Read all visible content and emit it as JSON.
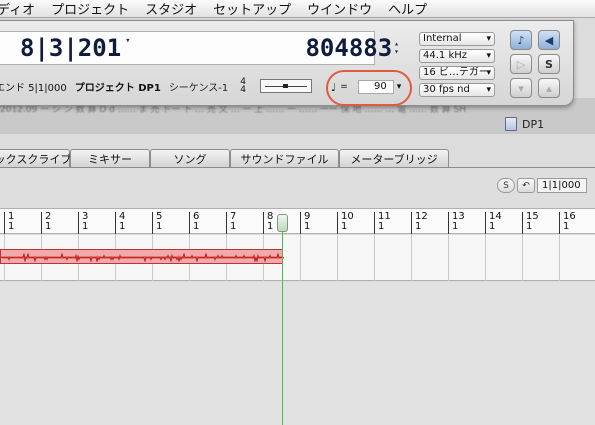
{
  "menubar": {
    "items": [
      "ディオ",
      "プロジェクト",
      "スタジオ",
      "セットアップ",
      "ウインドウ",
      "ヘルプ"
    ]
  },
  "transport": {
    "counter_main": "8|3|201",
    "counter_secondary": "804883",
    "end_label": "エンド 5|1|000",
    "project_label": "プロジェクト DP1",
    "sequence_label": "シーケンス-1",
    "time_sig_top": "4",
    "time_sig_bottom": "4",
    "tempo_symbol": "♩",
    "tempo_equals": "=",
    "tempo_value": "90",
    "sync_source": "Internal",
    "sample_rate": "44.1 kHz",
    "bit_depth": "16 ビ…テガー",
    "frame_rate": "30 fps nd",
    "buttons": {
      "click_label": "♪",
      "wait_label": "◀",
      "play_label": "▷",
      "sync_label": "S",
      "countoff_label": "▾",
      "overdub_label": "▴"
    }
  },
  "document": {
    "title": "DP1",
    "blurred_text": "    2012.09              ー シ ン   数 算     D  d    ……  ま 売  ドー  ト … 売 文 …  ー  上 ……  ー  ……  ーー   保 地 ……  … 電 ……  数 算 SH"
  },
  "tabs": [
    "ックスクライブ",
    "ミキサー",
    "ソング",
    "サウンドファイル",
    "メーターブリッジ"
  ],
  "timeline": {
    "s_button": "S",
    "back_button": "↶",
    "position": "1|1|000",
    "ruler_marks": [
      {
        "bar": "1",
        "beat": "1"
      },
      {
        "bar": "2",
        "beat": "1"
      },
      {
        "bar": "3",
        "beat": "1"
      },
      {
        "bar": "4",
        "beat": "1"
      },
      {
        "bar": "5",
        "beat": "1"
      },
      {
        "bar": "6",
        "beat": "1"
      },
      {
        "bar": "7",
        "beat": "1"
      },
      {
        "bar": "8",
        "beat": "1"
      },
      {
        "bar": "9",
        "beat": "1"
      },
      {
        "bar": "10",
        "beat": "1"
      },
      {
        "bar": "11",
        "beat": "1"
      },
      {
        "bar": "12",
        "beat": "1"
      },
      {
        "bar": "13",
        "beat": "1"
      },
      {
        "bar": "14",
        "beat": "1"
      },
      {
        "bar": "15",
        "beat": "1"
      },
      {
        "bar": "16",
        "beat": "1"
      }
    ]
  },
  "colors": {
    "playhead": "#45c245",
    "region_fill": "#f2a9a9",
    "region_wave": "#c21d1d",
    "highlight_ring": "#e05a3d"
  }
}
